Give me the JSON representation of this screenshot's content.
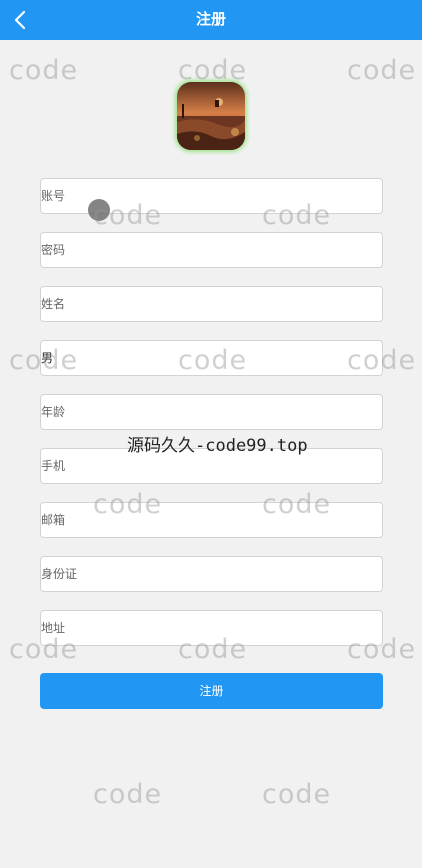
{
  "header": {
    "title": "注册",
    "back_icon": "chevron-left-icon"
  },
  "avatar": {
    "icon": "landscape-avatar"
  },
  "form": {
    "account_placeholder": "账号",
    "password_placeholder": "密码",
    "name_placeholder": "姓名",
    "gender_value": "男",
    "age_placeholder": "年龄",
    "phone_placeholder": "手机",
    "email_placeholder": "邮箱",
    "id_card_placeholder": "身份证",
    "address_placeholder": "地址",
    "submit_label": "注册"
  },
  "watermark": {
    "text": "code",
    "center_text": "源码久久-code99.top"
  },
  "colors": {
    "accent": "#2196f3",
    "background": "#f1f1f1"
  }
}
